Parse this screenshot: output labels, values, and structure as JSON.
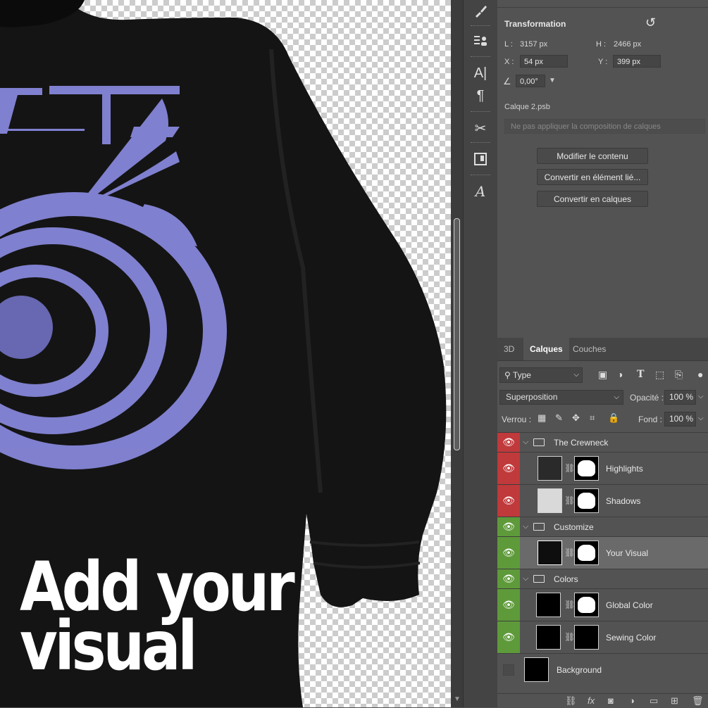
{
  "canvas": {
    "overlay_lines": [
      "Add your",
      "visual"
    ],
    "shirt_color": "#111111",
    "print_color": "#8888dd"
  },
  "properties": {
    "title": "Transformation",
    "w_label": "L :",
    "w_value": "3157 px",
    "h_label": "H :",
    "h_value": "2466 px",
    "x_label": "X :",
    "x_value": "54 px",
    "y_label": "Y :",
    "y_value": "399 px",
    "angle_value": "0,00°",
    "file_name": "Calque 2.psb",
    "comp_placeholder": "Ne pas appliquer la composition de calques",
    "buttons": [
      "Modifier le contenu",
      "Convertir en élément lié...",
      "Convertir en calques"
    ]
  },
  "layers_panel": {
    "tabs": [
      "3D",
      "Calques",
      "Couches"
    ],
    "active_tab": "Calques",
    "filter_label": "Type",
    "blend_mode": "Superposition",
    "opacity_label": "Opacité :",
    "opacity_value": "100 %",
    "lock_label": "Verrou :",
    "fill_label": "Fond :",
    "fill_value": "100 %",
    "layers": [
      {
        "name": "The Crewneck",
        "kind": "group",
        "color": "#c0393b"
      },
      {
        "name": "Highlights",
        "kind": "layer",
        "color": "#c0393b"
      },
      {
        "name": "Shadows",
        "kind": "layer",
        "color": "#c0393b"
      },
      {
        "name": "Customize",
        "kind": "group",
        "color": "#5e9a3a"
      },
      {
        "name": "Your Visual",
        "kind": "smart",
        "color": "#5e9a3a"
      },
      {
        "name": "Colors",
        "kind": "group",
        "color": "#5e9a3a"
      },
      {
        "name": "Global Color",
        "kind": "layer",
        "color": "#5e9a3a"
      },
      {
        "name": "Sewing Color",
        "kind": "layer",
        "color": "#5e9a3a"
      },
      {
        "name": "Background",
        "kind": "background",
        "color": ""
      }
    ]
  }
}
